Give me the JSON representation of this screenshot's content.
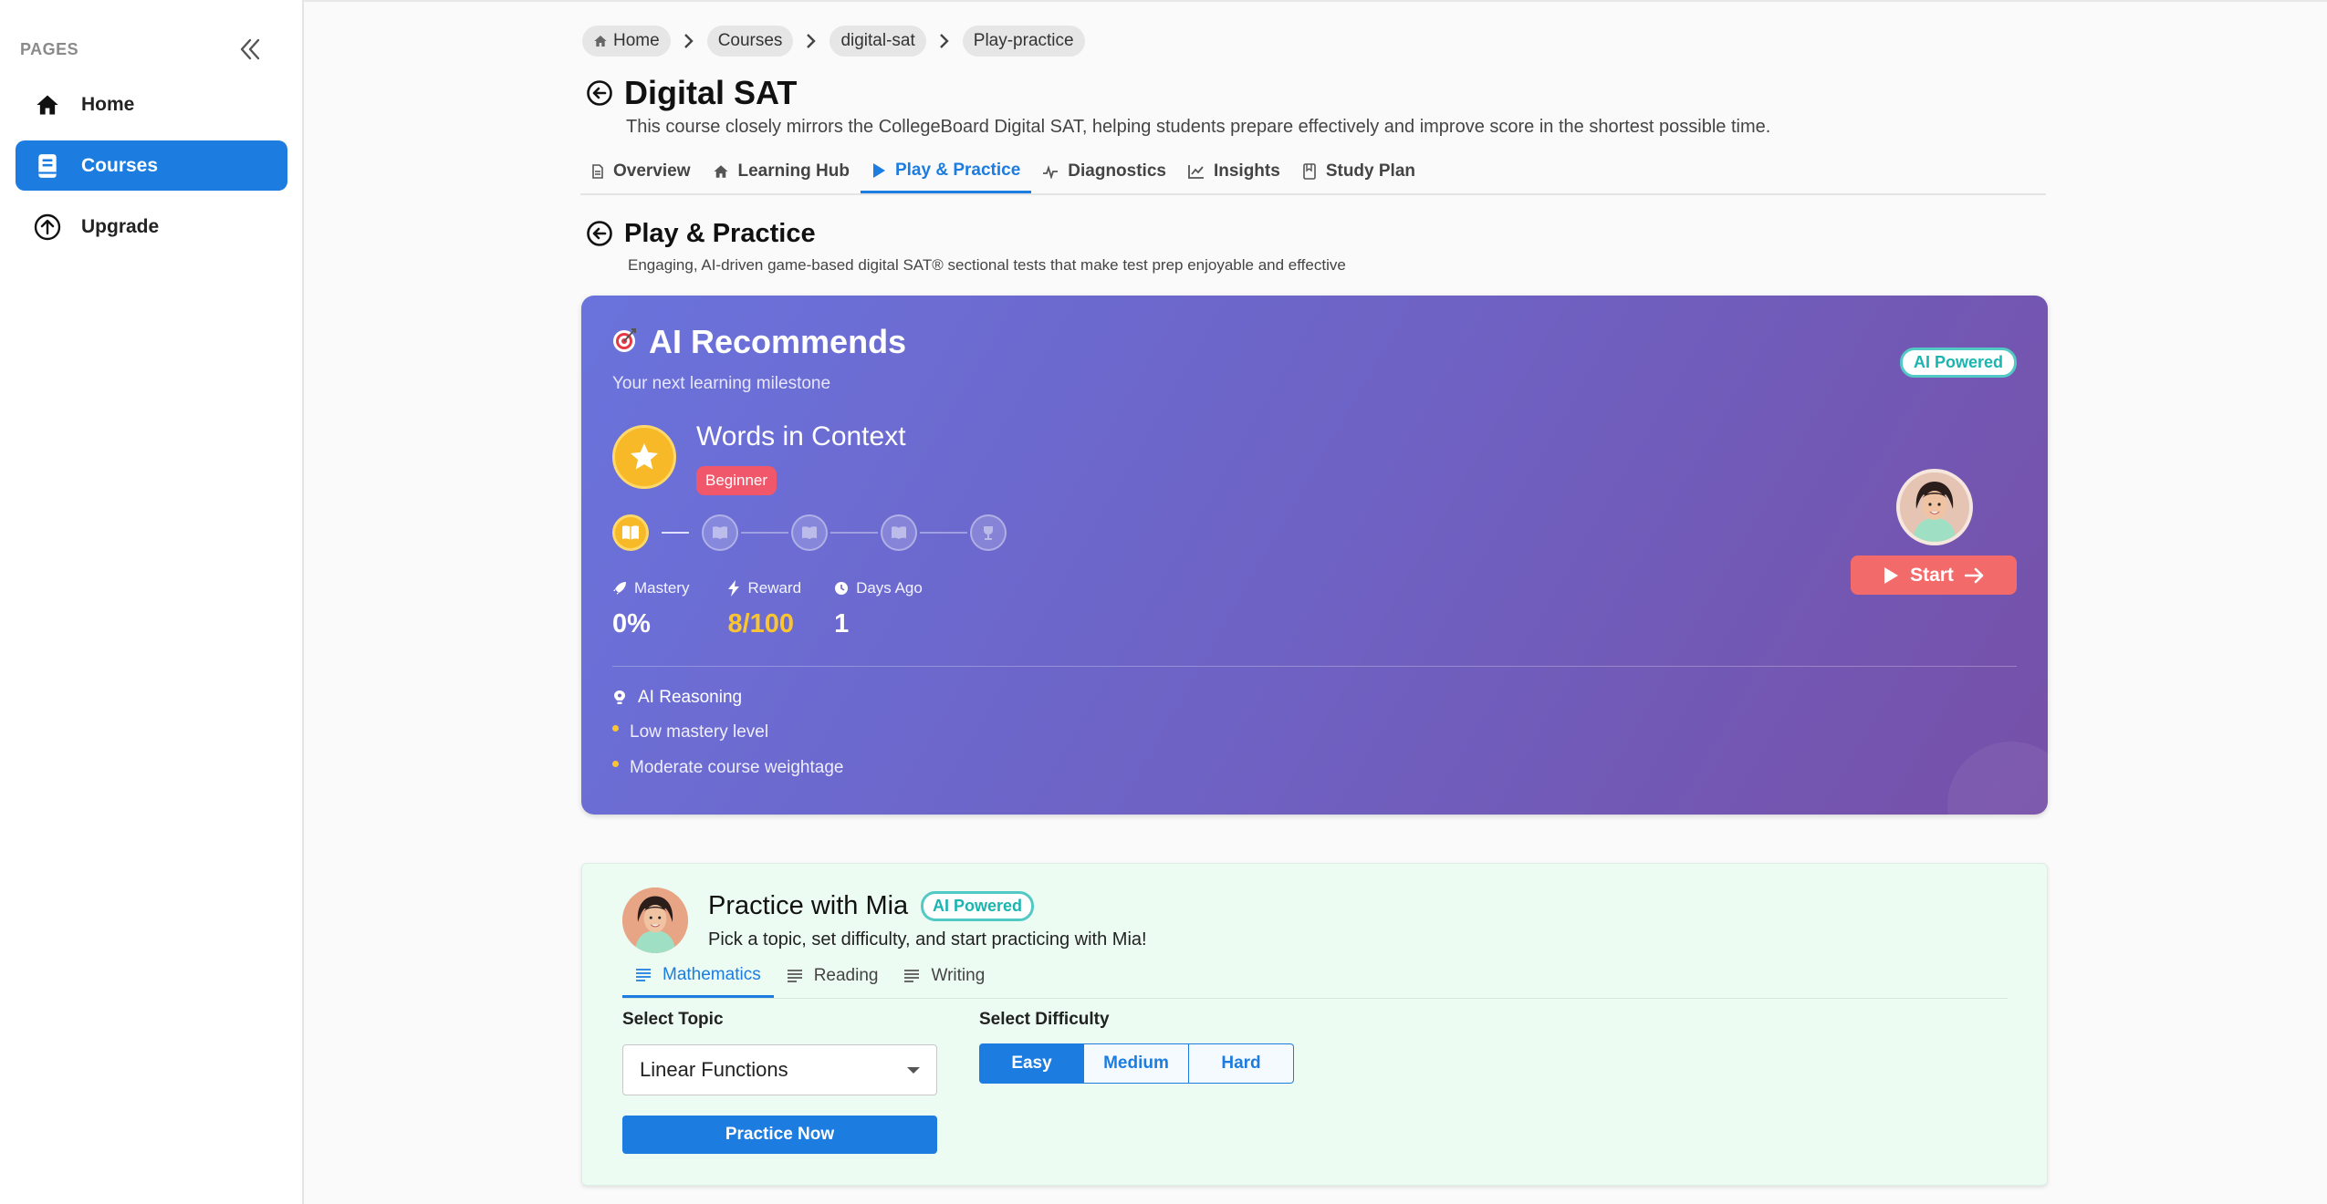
{
  "sidebar": {
    "section_label": "PAGES",
    "items": [
      {
        "label": "Home",
        "icon": "home-icon"
      },
      {
        "label": "Courses",
        "icon": "book-icon",
        "active": true
      },
      {
        "label": "Upgrade",
        "icon": "upgrade-icon"
      }
    ],
    "accent_color": "#1c7ce0"
  },
  "breadcrumb": [
    "Home",
    "Courses",
    "digital-sat",
    "Play-practice"
  ],
  "course": {
    "title": "Digital SAT",
    "description": "This course closely mirrors the CollegeBoard Digital SAT, helping students prepare effectively and improve score in the shortest possible time."
  },
  "tabs": [
    {
      "label": "Overview",
      "icon": "document-icon"
    },
    {
      "label": "Learning Hub",
      "icon": "home-icon"
    },
    {
      "label": "Play & Practice",
      "icon": "play-icon",
      "active": true
    },
    {
      "label": "Diagnostics",
      "icon": "pulse-icon"
    },
    {
      "label": "Insights",
      "icon": "chart-icon"
    },
    {
      "label": "Study Plan",
      "icon": "bookmark-icon"
    }
  ],
  "section": {
    "title": "Play & Practice",
    "description": "Engaging, AI-driven game-based digital SAT® sectional tests that make test prep enjoyable and effective"
  },
  "ai_recommends": {
    "title": "AI Recommends",
    "subtitle": "Your next learning milestone",
    "badge": "AI Powered",
    "topic": "Words in Context",
    "level": "Beginner",
    "progress_steps_completed": 1,
    "progress_steps_total": 5,
    "stats": {
      "mastery_label": "Mastery",
      "mastery_value": "0%",
      "reward_label": "Reward",
      "reward_value": "8/100",
      "days_label": "Days Ago",
      "days_value": "1"
    },
    "reasoning_title": "AI Reasoning",
    "reasons": [
      "Low mastery level",
      "Moderate course weightage"
    ],
    "start_label": "Start",
    "gradient_colors": [
      "#6a73dc",
      "#7650a8"
    ]
  },
  "mia": {
    "title": "Practice with Mia",
    "badge": "AI Powered",
    "subtitle": "Pick a topic, set difficulty, and start practicing with Mia!",
    "subject_tabs": [
      {
        "label": "Mathematics",
        "active": true
      },
      {
        "label": "Reading"
      },
      {
        "label": "Writing"
      }
    ],
    "topic_label": "Select Topic",
    "topic_value": "Linear Functions",
    "difficulty_label": "Select Difficulty",
    "difficulties": [
      {
        "label": "Easy",
        "active": true
      },
      {
        "label": "Medium"
      },
      {
        "label": "Hard"
      }
    ],
    "practice_label": "Practice Now",
    "background_color": "#ecfcf2"
  }
}
